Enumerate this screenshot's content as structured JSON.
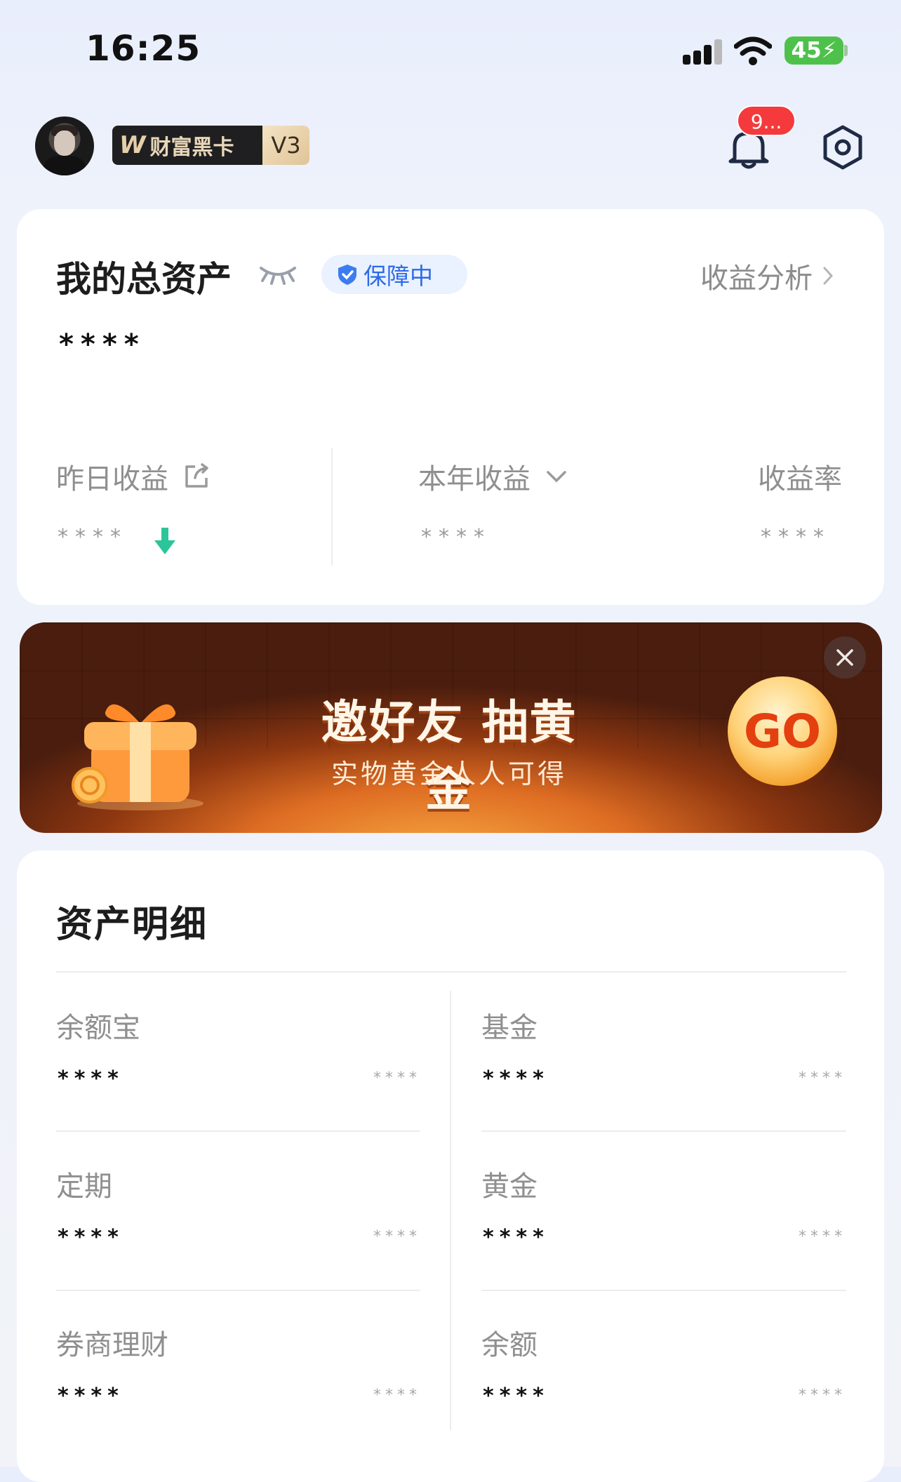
{
  "status_bar": {
    "time": "16:25",
    "battery": "45"
  },
  "header": {
    "badge_label": "财富黑卡",
    "badge_logo": "W",
    "level": "V3",
    "notification_count": "9..."
  },
  "overview": {
    "title": "我的总资产",
    "protection": "保障中",
    "analysis_link": "收益分析",
    "total": "****",
    "yesterday_label": "昨日收益",
    "yesterday_value": "****",
    "year_label": "本年收益",
    "year_value": "****",
    "rate_label": "收益率",
    "rate_value": "****"
  },
  "banner": {
    "title": "邀好友 抽黄金",
    "subtitle": "实物黄金人人可得",
    "go": "GO"
  },
  "details": {
    "title": "资产明细",
    "items": [
      {
        "name": "余额宝",
        "value": "****",
        "sub": "****"
      },
      {
        "name": "基金",
        "value": "****",
        "sub": "****"
      },
      {
        "name": "定期",
        "value": "****",
        "sub": "****"
      },
      {
        "name": "黄金",
        "value": "****",
        "sub": "****"
      },
      {
        "name": "券商理财",
        "value": "****",
        "sub": "****"
      },
      {
        "name": "余额",
        "value": "****",
        "sub": "****"
      }
    ]
  },
  "colors": {
    "accent_blue": "#2c6be8",
    "badge_red": "#f43a3c",
    "banner_orange": "#de6d23"
  },
  "icons": [
    "signal-icon",
    "wifi-icon",
    "battery-icon",
    "avatar",
    "bell-icon",
    "settings-icon",
    "eye-closed-icon",
    "shield-icon",
    "chevron-right-icon",
    "share-icon",
    "chevron-down-icon",
    "trend-down-icon",
    "gift-icon",
    "close-icon"
  ]
}
